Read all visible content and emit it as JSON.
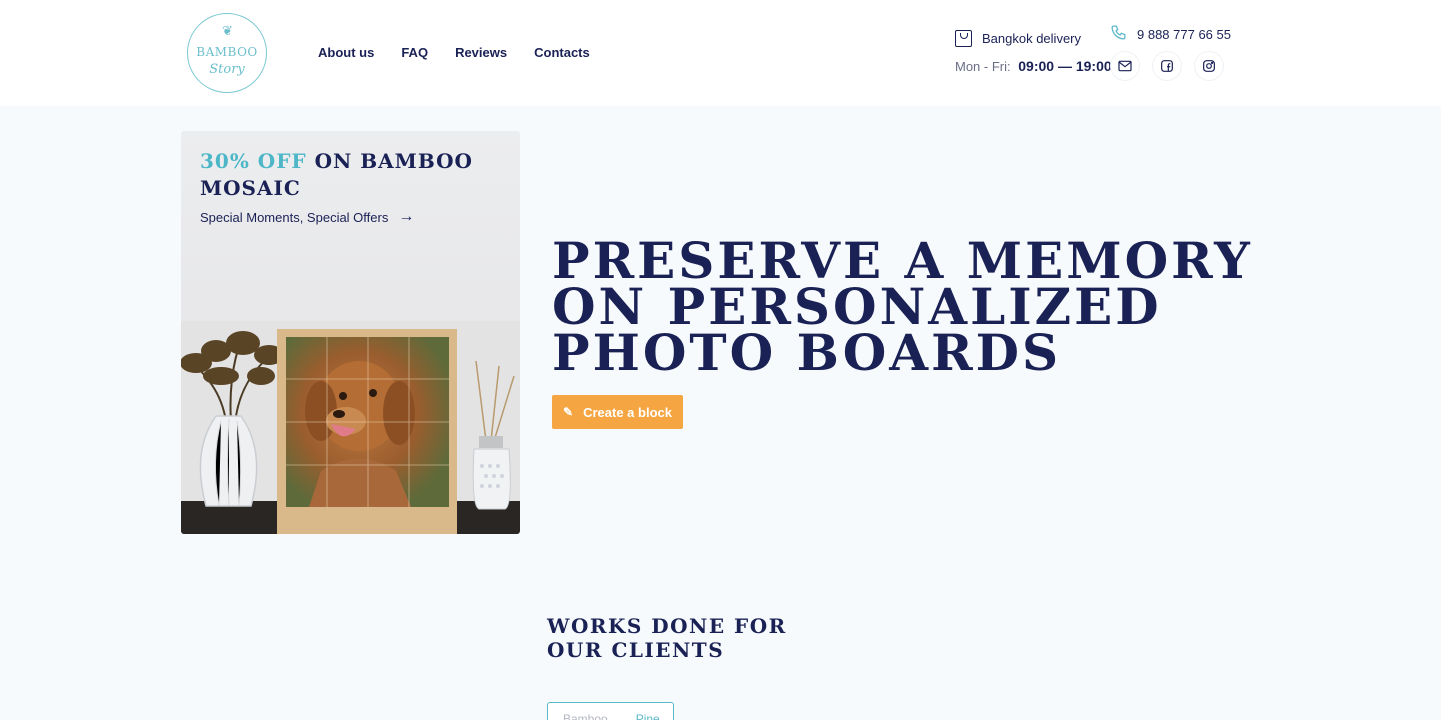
{
  "logo": {
    "brand": "BAMBOO",
    "script": "Story"
  },
  "nav": {
    "items": [
      "About us",
      "FAQ",
      "Reviews",
      "Contacts"
    ]
  },
  "contact": {
    "delivery": "Bangkok delivery",
    "hours_label": "Mon - Fri:",
    "hours_value": "09:00 — 19:00",
    "phone": "9 888 777 66 55"
  },
  "socials": [
    "mail-icon",
    "facebook-icon",
    "instagram-icon"
  ],
  "promo": {
    "title_accent": "30% OFF",
    "title_rest": "ON BAMBOO MOSAIC",
    "subtitle": "Special Moments, Special Offers"
  },
  "hero": {
    "title": "Preserve a memory on personalized photo boards",
    "button": "Create a block"
  },
  "works": {
    "title": "Works done for our clients",
    "tabs": [
      "Bamboo",
      "Pine"
    ]
  },
  "colors": {
    "navy": "#1a2155",
    "accent": "#4db7c7",
    "button": "#f5a642"
  }
}
